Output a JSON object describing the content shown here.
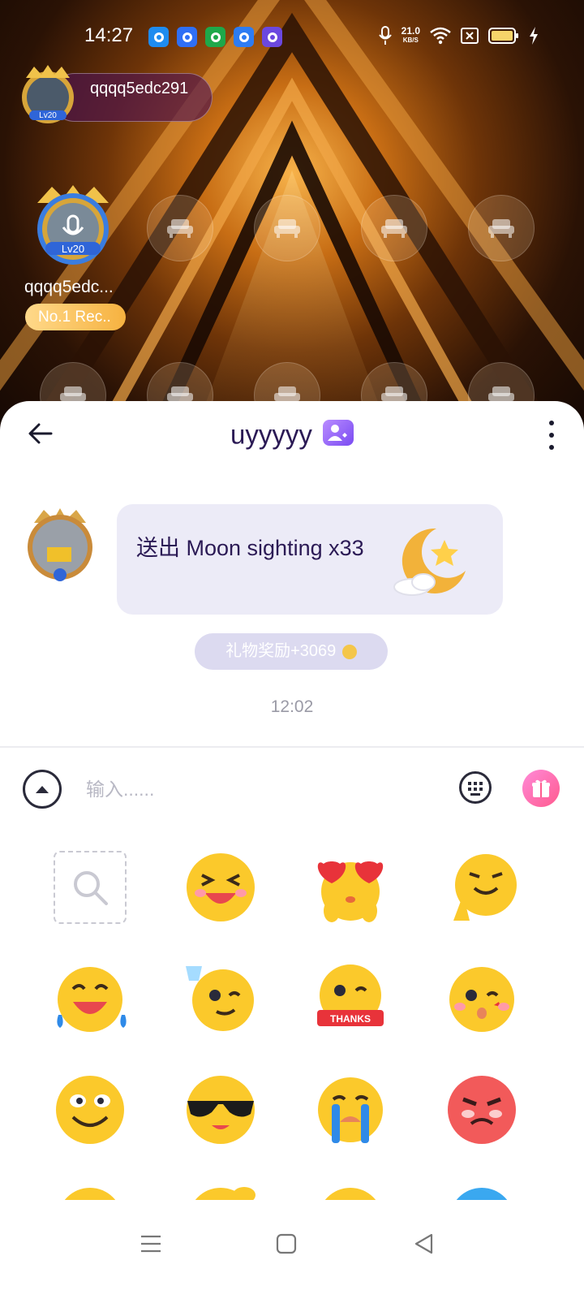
{
  "status_bar": {
    "time": "14:27",
    "net_speed_value": "21.0",
    "net_speed_unit": "KB/S",
    "notification_colors": [
      "#1e8cf0",
      "#2f6ff5",
      "#1ea84a",
      "#2d7cf3",
      "#6b48e0"
    ]
  },
  "room": {
    "host_name": "qqqq5edc291",
    "host_level": "Lv20",
    "seat_user_name": "qqqq5edc...",
    "seat_user_level": "Lv20",
    "seat_badge": "No.1 Rec..",
    "empty_seat_icon": "sofa-icon"
  },
  "chat": {
    "title": "uyyyyy",
    "message_text": "送出 Moon sighting x33",
    "reward_text": "礼物奖励+3069",
    "timestamp": "12:02"
  },
  "input": {
    "placeholder": "输入......"
  },
  "emoji_panel": {
    "items": [
      "search-icon",
      "laughing-emoji",
      "heart-eyes-emoji",
      "praying-emoji",
      "tears-of-joy-emoji",
      "toast-wink-emoji",
      "thanks-emoji",
      "kiss-emoji",
      "smiling-emoji",
      "sunglasses-emoji",
      "crying-emoji",
      "angry-emoji"
    ]
  },
  "colors": {
    "accent": "#7a4bf2",
    "title_text": "#2b1a55",
    "bubble_bg": "#ecebf7",
    "gift_button": "#ff5a8e"
  }
}
